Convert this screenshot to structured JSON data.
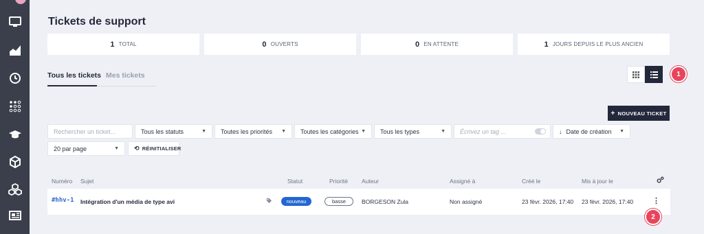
{
  "page": {
    "title": "Tickets de support"
  },
  "stats": [
    {
      "num": "1",
      "label": "TOTAL"
    },
    {
      "num": "0",
      "label": "OUVERTS"
    },
    {
      "num": "0",
      "label": "EN ATTENTE"
    },
    {
      "num": "1",
      "label": "JOURS DEPUIS LE PLUS ANCIEN"
    }
  ],
  "tabs": {
    "all": "Tous les tickets",
    "mine": "Mes tickets"
  },
  "actions": {
    "new_ticket": "NOUVEAU TICKET",
    "reset": "RÉINITIALISER"
  },
  "filters": {
    "search_placeholder": "Rechercher un ticket...",
    "status": "Tous les statuts",
    "priority": "Toutes les priorités",
    "category": "Toutes les catégories",
    "type": "Tous les types",
    "tag_placeholder": "Écrivez un tag ...",
    "sort": "Date de création",
    "per_page": "20 par page"
  },
  "table": {
    "headers": {
      "number": "Numéro",
      "subject": "Sujet",
      "status": "Statut",
      "priority": "Priorité",
      "author": "Auteur",
      "assignee": "Assigné à",
      "created": "Créé le",
      "updated": "Mis à jour le"
    },
    "rows": [
      {
        "id": "#hhv-1",
        "subject": "Intégration d'un média de type avi",
        "status": "nouveau",
        "priority": "basse",
        "author": "BORGESON Zula",
        "assignee": "Non assigné",
        "created": "23 févr. 2026, 17:40",
        "updated": "23 févr. 2026, 17:40"
      }
    ]
  },
  "annotations": {
    "badge1": "1",
    "badge2": "2"
  },
  "colors": {
    "sidebar": "#3a3f4b",
    "primary": "#23283a",
    "accent_blue": "#2366d1",
    "badge_red": "#e8445b",
    "background": "#eef0f6"
  },
  "icons": [
    "monitor-icon",
    "chart-icon",
    "clock-icon",
    "apps-grid-icon",
    "graduation-cap-icon",
    "box-icon",
    "boxes-icon",
    "newspaper-icon",
    "grid-view-icon",
    "list-view-icon",
    "plus-icon",
    "reset-icon",
    "sort-down-icon",
    "tag-icon",
    "settings-icon",
    "more-vertical-icon"
  ]
}
